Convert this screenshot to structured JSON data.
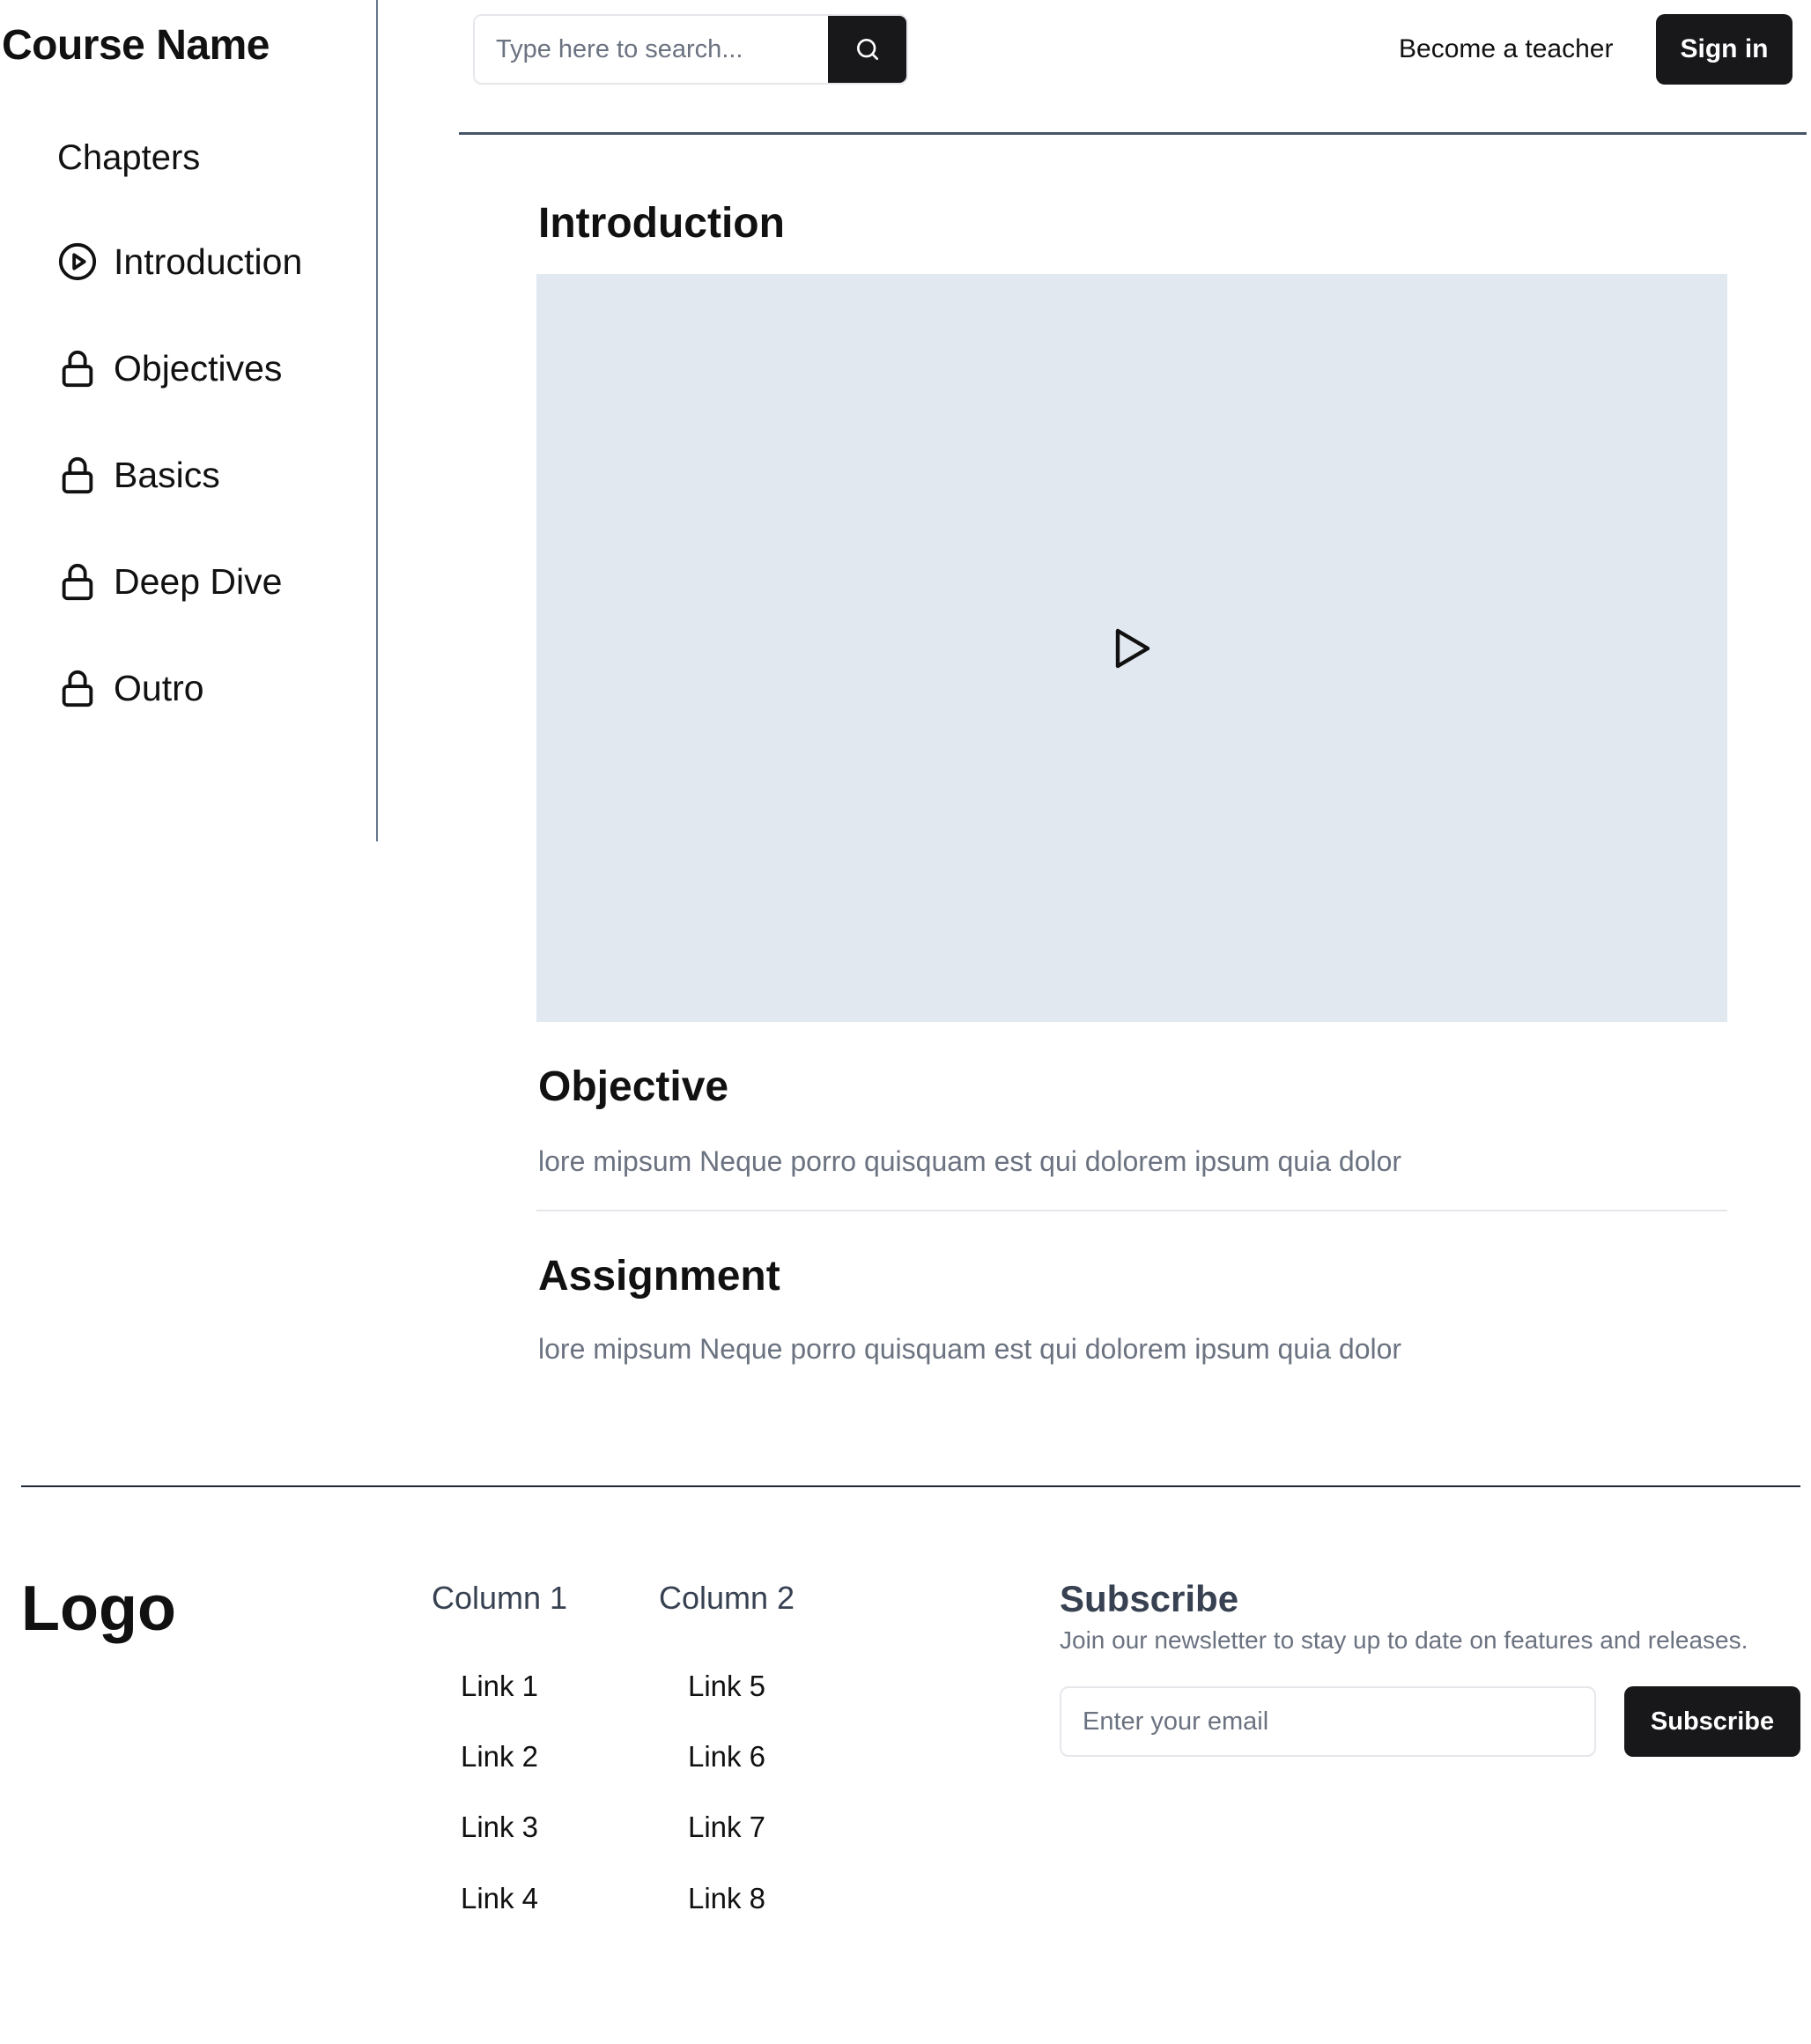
{
  "sidebar": {
    "course_name": "Course Name",
    "chapters_heading": "Chapters",
    "chapters": [
      {
        "label": "Introduction",
        "icon": "play-circle-icon"
      },
      {
        "label": "Objectives",
        "icon": "lock-icon"
      },
      {
        "label": "Basics",
        "icon": "lock-icon"
      },
      {
        "label": "Deep Dive",
        "icon": "lock-icon"
      },
      {
        "label": "Outro",
        "icon": "lock-icon"
      }
    ]
  },
  "header": {
    "search_placeholder": "Type here to search...",
    "search_icon": "search-icon",
    "become_teacher": "Become a teacher",
    "sign_in": "Sign in"
  },
  "main": {
    "intro_title": "Introduction",
    "video_icon": "play-icon",
    "objective_title": "Objective",
    "objective_text": "lore mipsum Neque porro quisquam est qui dolorem ipsum quia dolor",
    "assignment_title": "Assignment",
    "assignment_text": "lore mipsum Neque porro quisquam est qui dolorem ipsum quia dolor"
  },
  "footer": {
    "logo": "Logo",
    "columns": [
      {
        "title": "Column 1",
        "links": [
          "Link 1",
          "Link 2",
          "Link 3",
          "Link 4"
        ]
      },
      {
        "title": "Column 2",
        "links": [
          "Link 5",
          "Link 6",
          "Link 7",
          "Link 8"
        ]
      }
    ],
    "subscribe_title": "Subscribe",
    "subscribe_desc": "Join our newsletter to stay up to date on features and releases.",
    "email_placeholder": "Enter your email",
    "subscribe_button": "Subscribe"
  },
  "colors": {
    "primary_button": "#18181b",
    "video_placeholder": "#e2e8f0",
    "muted_text": "#6b7280"
  }
}
